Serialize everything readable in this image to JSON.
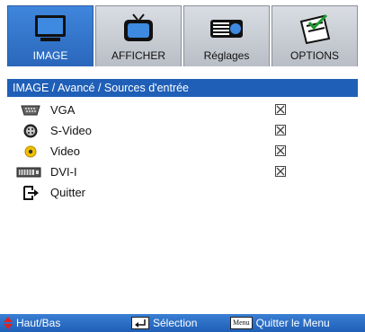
{
  "colors": {
    "accent": "#1f5fb7",
    "active_tab": "#2f74cf",
    "checkbox": "#444444",
    "video_icon": "#f0c000"
  },
  "tabs": [
    {
      "label": "IMAGE",
      "icon": "monitor-icon",
      "active": true
    },
    {
      "label": "AFFICHER",
      "icon": "tv-icon",
      "active": false
    },
    {
      "label": "Réglages",
      "icon": "projector-icon",
      "active": false
    },
    {
      "label": "OPTIONS",
      "icon": "checklist-icon",
      "active": false
    }
  ],
  "breadcrumb": "IMAGE / Avancé / Sources d'entrée",
  "items": [
    {
      "label": "VGA",
      "icon": "vga-port-icon",
      "checked": true
    },
    {
      "label": "S-Video",
      "icon": "svideo-port-icon",
      "checked": true
    },
    {
      "label": "Video",
      "icon": "video-port-icon",
      "checked": true
    },
    {
      "label": "DVI-I",
      "icon": "dvi-port-icon",
      "checked": true
    },
    {
      "label": "Quitter",
      "icon": "exit-icon",
      "checked": false
    }
  ],
  "statusbar": {
    "navigate": "Haut/Bas",
    "select": "Sélection",
    "menu_key": "Menu",
    "exit": "Quitter le Menu"
  }
}
